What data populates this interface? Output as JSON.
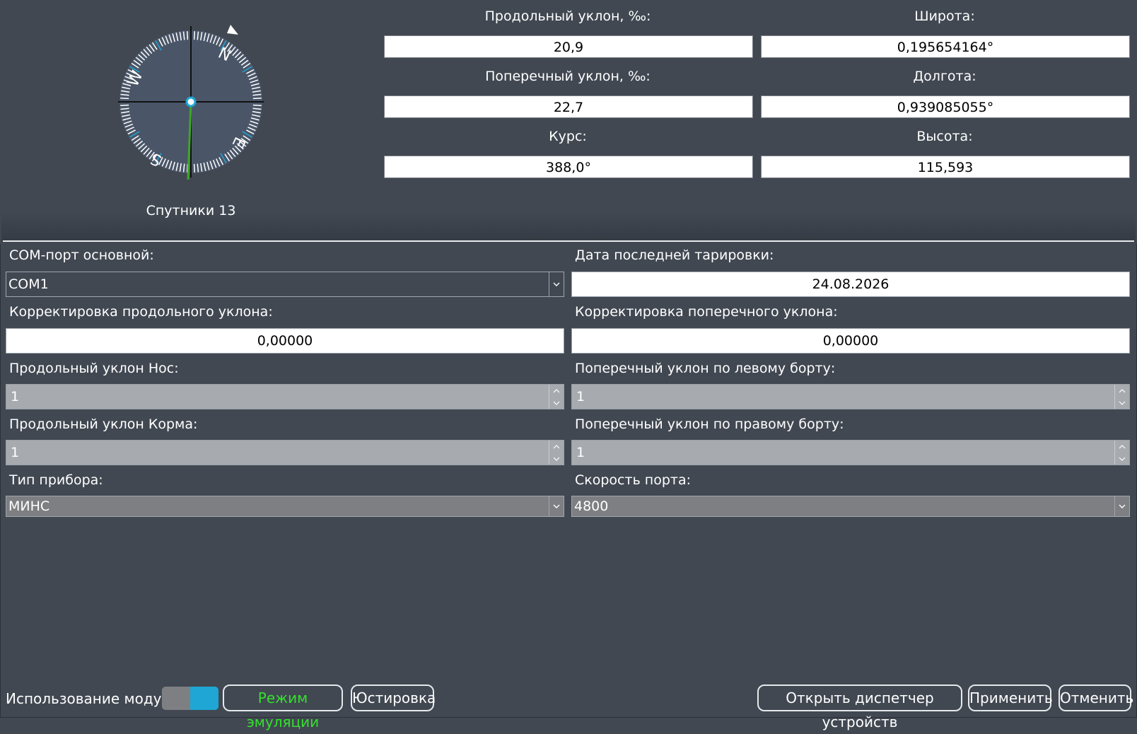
{
  "compass": {
    "icon": "compass-icon",
    "labels": [
      "N",
      "E",
      "S",
      "W"
    ],
    "satellites_label": "Спутники 13"
  },
  "readouts": {
    "longitudinal_label": "Продольный уклон, ‰:",
    "longitudinal_value": "20,9",
    "transverse_label": "Поперечный уклон, ‰:",
    "transverse_value": "22,7",
    "course_label": "Курс:",
    "course_value": "388,0°",
    "latitude_label": "Широта:",
    "latitude_value": "0,195654164°",
    "longitude_label": "Долгота:",
    "longitude_value": "0,939085055°",
    "altitude_label": "Высота:",
    "altitude_value": "115,593"
  },
  "settings": {
    "com_port_label": "COM-порт основной:",
    "com_port_value": "COM1",
    "calibration_date_label": "Дата последней тарировки:",
    "calibration_date_value": "24.08.2026",
    "long_correction_label": "Корректировка продольного уклона:",
    "long_correction_value": "0,00000",
    "trans_correction_label": "Корректировка поперечного уклона:",
    "trans_correction_value": "0,00000",
    "long_bow_label": "Продольный уклон Нос:",
    "long_bow_value": "1",
    "trans_left_label": "Поперечный уклон по левому борту:",
    "trans_left_value": "1",
    "long_stern_label": "Продольный уклон Корма:",
    "long_stern_value": "1",
    "trans_right_label": "Поперечный уклон по правому борту:",
    "trans_right_value": "1",
    "device_type_label": "Тип прибора:",
    "device_type_value": "МИНС",
    "port_speed_label": "Скорость порта:",
    "port_speed_value": "4800"
  },
  "bottom": {
    "module_usage_label": "Использование модуля",
    "emulation_button": "Режим эмуляции",
    "adjust_button": "Юстировка",
    "device_manager_button": "Открыть диспетчер устройств",
    "apply_button": "Применить",
    "cancel_button": "Отменить"
  },
  "colors": {
    "toggle_on": "#1fa6d4",
    "emulation_text": "#34e02c",
    "needle": "#3fa62a"
  }
}
